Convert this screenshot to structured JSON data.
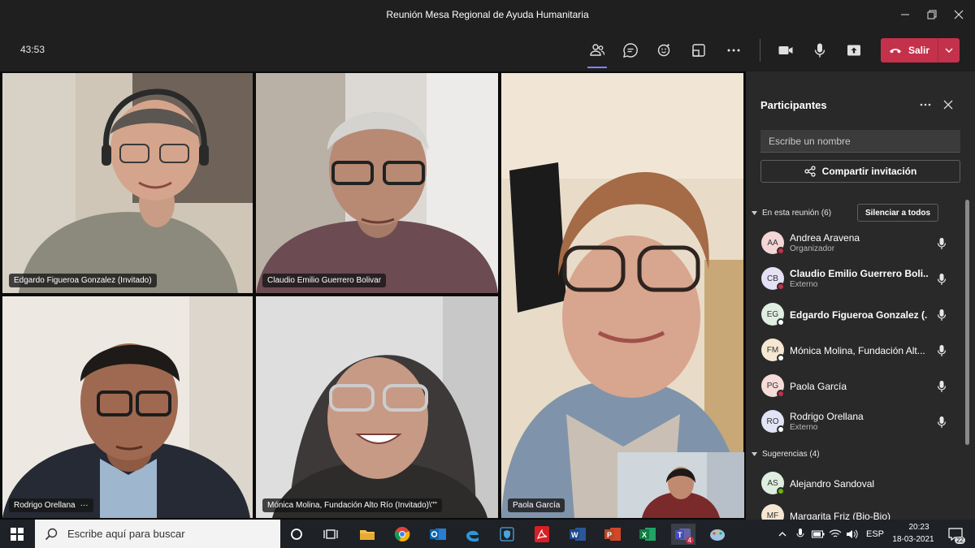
{
  "window": {
    "title": "Reunión Mesa Regional de Ayuda Humanitaria"
  },
  "toolbar": {
    "timer": "43:53",
    "leave_label": "Salir",
    "icons": [
      "participants-icon",
      "chat-icon",
      "reactions-icon",
      "share-tray-icon",
      "more-icon",
      "camera-icon",
      "mic-icon",
      "share-icon"
    ]
  },
  "tiles": [
    {
      "name": "Edgardo Figueroa Gonzalez (Invitado)",
      "more": ""
    },
    {
      "name": "Claudio Emilio Guerrero Bolivar",
      "more": ""
    },
    {
      "name": "Paola García",
      "more": ""
    },
    {
      "name": "Rodrigo Orellana",
      "more": "···"
    },
    {
      "name": "Mónica Molina, Fundación Alto Río (Invitado)\\\"\"",
      "more": ""
    }
  ],
  "panel": {
    "title": "Participantes",
    "search_placeholder": "Escribe un nombre",
    "invite_label": "Compartir invitación",
    "in_meeting_label": "En esta reunión (6)",
    "mute_all_label": "Silenciar a todos",
    "suggestions_label": "Sugerencias (4)",
    "participants": [
      {
        "initials": "AA",
        "name": "Andrea Aravena",
        "role": "Organizador",
        "bold": false,
        "presence": "busy"
      },
      {
        "initials": "CB",
        "name": "Claudio Emilio Guerrero Boli...",
        "role": "Externo",
        "bold": true,
        "presence": "busy"
      },
      {
        "initials": "EG",
        "name": "Edgardo Figueroa Gonzalez (...",
        "role": "",
        "bold": true,
        "presence": "offline"
      },
      {
        "initials": "FM",
        "name": "Mónica Molina, Fundación Alt...",
        "role": "",
        "bold": false,
        "presence": "offline"
      },
      {
        "initials": "PG",
        "name": "Paola García",
        "role": "",
        "bold": false,
        "presence": "busy"
      },
      {
        "initials": "RO",
        "name": "Rodrigo Orellana",
        "role": "Externo",
        "bold": false,
        "presence": "offline"
      }
    ],
    "suggestions": [
      {
        "initials": "AS",
        "name": "Alejandro Sandoval",
        "presence": "available"
      },
      {
        "initials": "MF",
        "name": "Margarita Friz (Bio-Bio)",
        "presence": "offline"
      }
    ]
  },
  "taskbar": {
    "search_placeholder": "Escribe aquí para buscar",
    "language": "ESP",
    "time": "20:23",
    "date": "18-03-2021",
    "notification_count": "22",
    "teams_badge": "4"
  },
  "colors": {
    "leave": "#c4314b",
    "accent": "#7f85f5",
    "panel_bg": "#292929",
    "toolbar_bg": "#1f1f1f"
  }
}
